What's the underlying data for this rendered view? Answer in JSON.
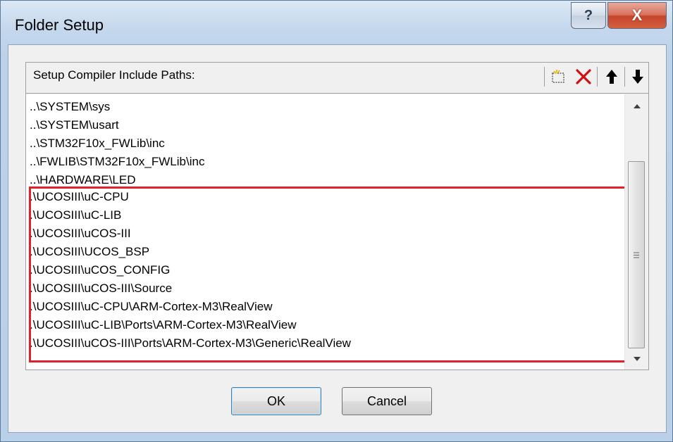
{
  "window": {
    "title": "Folder Setup",
    "help_label": "?",
    "close_label": "X"
  },
  "group": {
    "label": "Setup Compiler Include Paths:",
    "toolbar": {
      "new_icon": "new-folder-icon",
      "delete_icon": "delete-x-icon",
      "up_icon": "move-up-arrow-icon",
      "down_icon": "move-down-arrow-icon"
    }
  },
  "paths": [
    "..\\SYSTEM\\sys",
    "..\\SYSTEM\\usart",
    "..\\STM32F10x_FWLib\\inc",
    "..\\FWLIB\\STM32F10x_FWLib\\inc",
    "..\\HARDWARE\\LED",
    ".\\UCOSIII\\uC-CPU",
    ".\\UCOSIII\\uC-LIB",
    ".\\UCOSIII\\uCOS-III",
    ".\\UCOSIII\\UCOS_BSP",
    ".\\UCOSIII\\uCOS_CONFIG",
    ".\\UCOSIII\\uCOS-III\\Source",
    ".\\UCOSIII\\uC-CPU\\ARM-Cortex-M3\\RealView",
    ".\\UCOSIII\\uC-LIB\\Ports\\ARM-Cortex-M3\\RealView",
    ".\\UCOSIII\\uCOS-III\\Ports\\ARM-Cortex-M3\\Generic\\RealView"
  ],
  "buttons": {
    "ok": "OK",
    "cancel": "Cancel"
  },
  "colors": {
    "highlight": "#e0202c",
    "delete": "#d01010"
  }
}
